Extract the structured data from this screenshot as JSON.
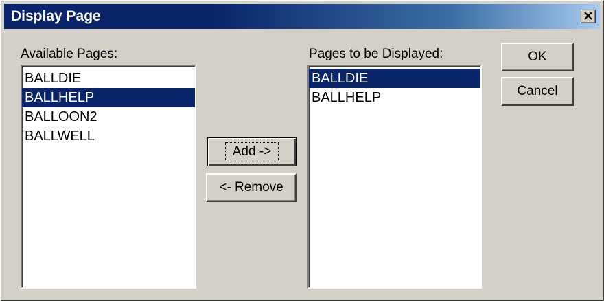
{
  "window": {
    "title": "Display Page"
  },
  "available": {
    "label": "Available Pages:",
    "items": [
      "BALLDIE",
      "BALLHELP",
      "BALLOON2",
      "BALLWELL"
    ],
    "selected_index": 1
  },
  "displayed": {
    "label": "Pages to be Displayed:",
    "items": [
      "BALLDIE",
      "BALLHELP"
    ],
    "selected_index": 0
  },
  "buttons": {
    "add": "Add ->",
    "remove": "<- Remove",
    "ok": "OK",
    "cancel": "Cancel"
  },
  "icons": {
    "close": "close-icon"
  },
  "colors": {
    "title_bar": "#0a246a",
    "selection": "#0a246a",
    "face": "#d4d0c8"
  }
}
